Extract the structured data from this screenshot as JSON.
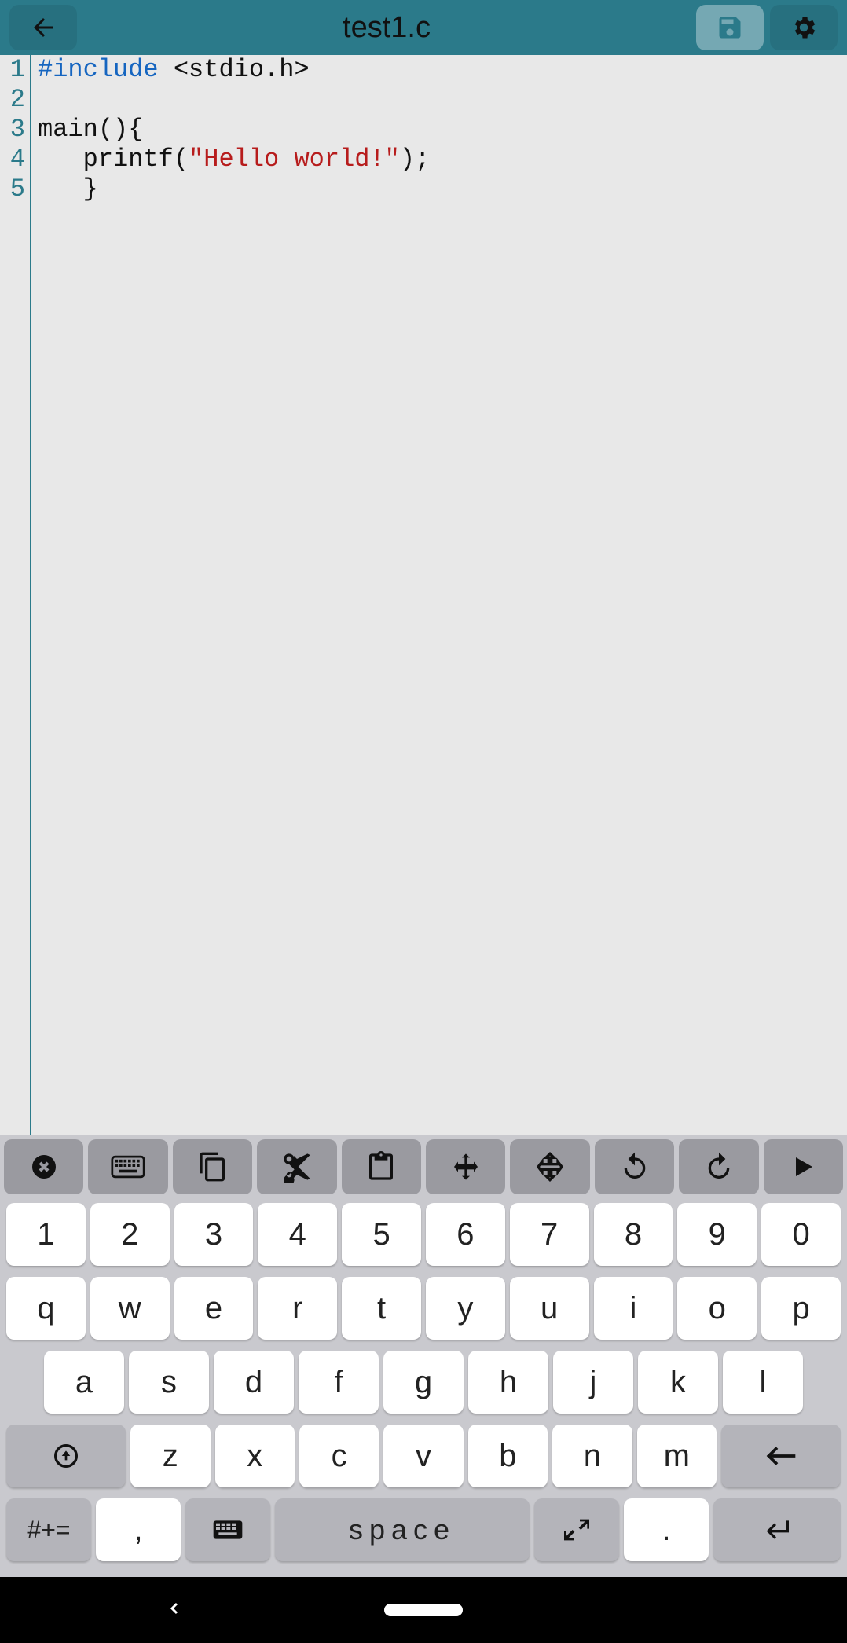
{
  "header": {
    "title": "test1.c"
  },
  "editor": {
    "lines": [
      {
        "num": "1",
        "tokens": [
          {
            "cls": "kw",
            "t": "#include"
          },
          {
            "cls": "txt",
            "t": " <stdio.h>"
          }
        ]
      },
      {
        "num": "2",
        "tokens": []
      },
      {
        "num": "3",
        "tokens": [
          {
            "cls": "txt",
            "t": "main(){"
          }
        ]
      },
      {
        "num": "4",
        "tokens": [
          {
            "cls": "txt",
            "t": "   printf("
          },
          {
            "cls": "str",
            "t": "\"Hello world!\""
          },
          {
            "cls": "txt",
            "t": ");"
          }
        ]
      },
      {
        "num": "5",
        "tokens": [
          {
            "cls": "txt",
            "t": "   }"
          }
        ]
      }
    ]
  },
  "toolbar": {
    "items": [
      "close",
      "keyboard",
      "copy",
      "cut",
      "paste",
      "move",
      "cursor-move",
      "undo",
      "redo",
      "play"
    ]
  },
  "keyboard": {
    "row1": [
      "1",
      "2",
      "3",
      "4",
      "5",
      "6",
      "7",
      "8",
      "9",
      "0"
    ],
    "row2": [
      "q",
      "w",
      "e",
      "r",
      "t",
      "y",
      "u",
      "i",
      "o",
      "p"
    ],
    "row3": [
      "a",
      "s",
      "d",
      "f",
      "g",
      "h",
      "j",
      "k",
      "l"
    ],
    "row4": [
      "z",
      "x",
      "c",
      "v",
      "b",
      "n",
      "m"
    ],
    "symbols_label": "#+=",
    "comma": ",",
    "space_label": "space",
    "period": "."
  }
}
